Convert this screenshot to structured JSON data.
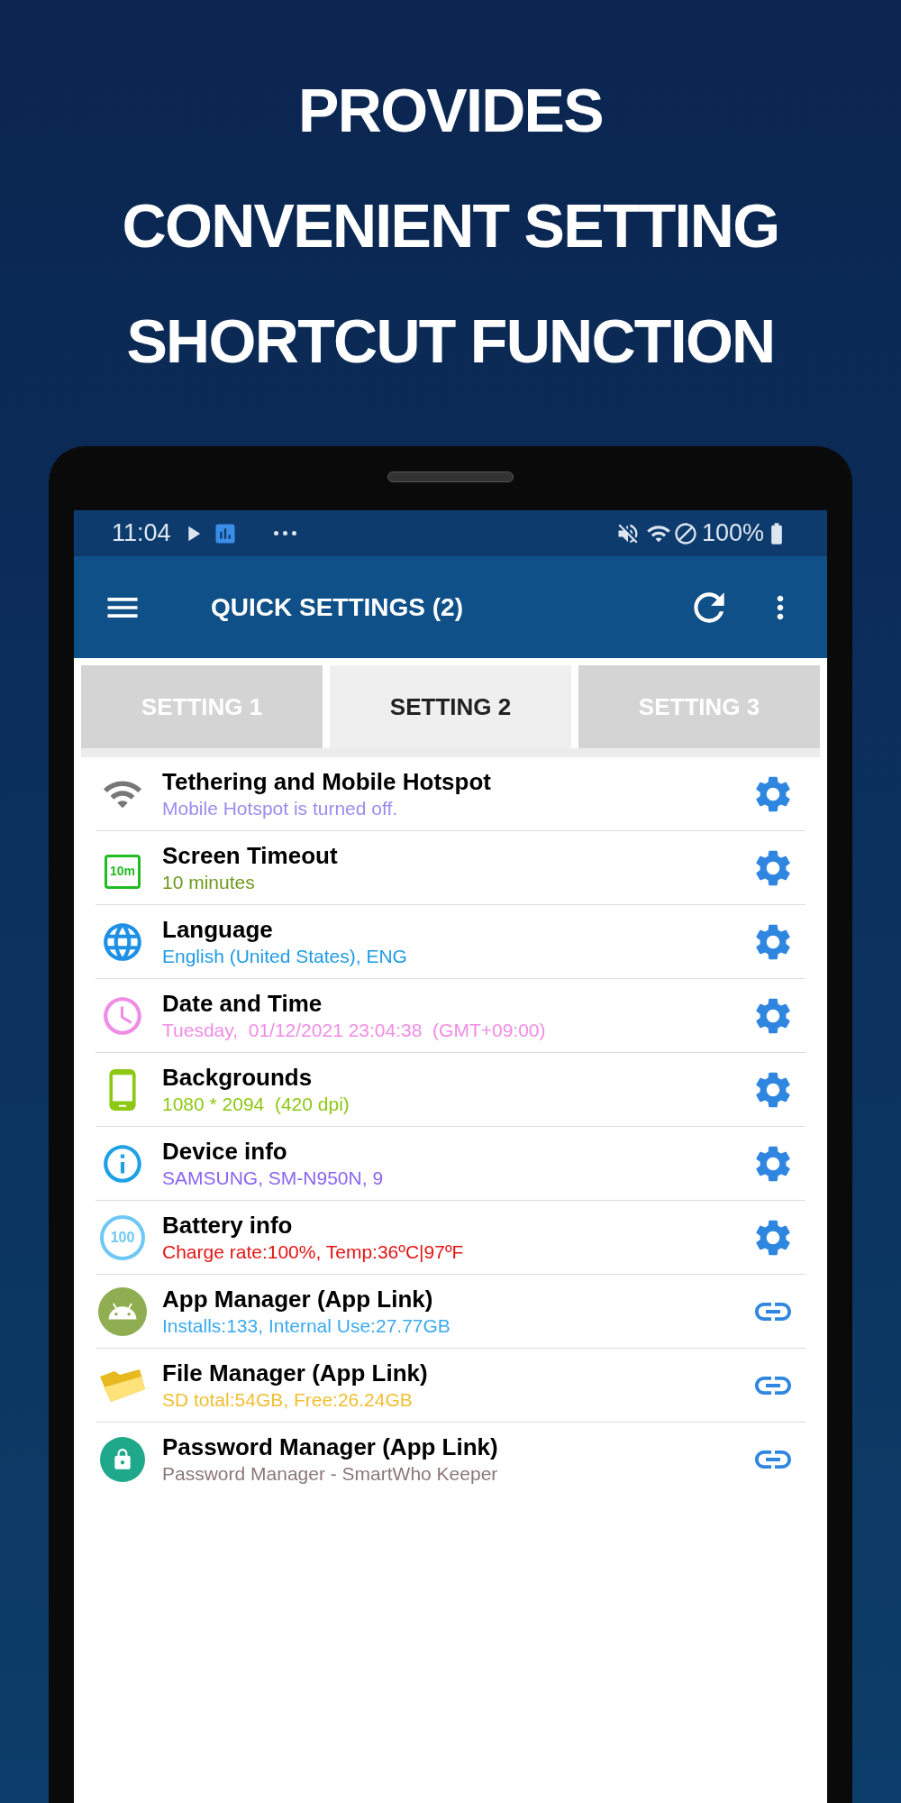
{
  "headline": [
    "PROVIDES",
    "CONVENIENT SETTING",
    "SHORTCUT FUNCTION"
  ],
  "status_bar": {
    "time": "11:04",
    "battery": "100%"
  },
  "app_bar": {
    "title": "QUICK SETTINGS (2)"
  },
  "tabs": [
    {
      "label": "SETTING 1",
      "selected": false
    },
    {
      "label": "SETTING 2",
      "selected": true
    },
    {
      "label": "SETTING 3",
      "selected": false
    }
  ],
  "items": [
    {
      "title": "Tethering and Mobile Hotspot",
      "subtitle": "Mobile Hotspot is turned off.",
      "color": "#9b8cf0",
      "kind": "setting"
    },
    {
      "title": "Screen Timeout",
      "subtitle": "10 minutes",
      "color": "#6e9a1e",
      "kind": "setting",
      "icon_text": "10m"
    },
    {
      "title": "Language",
      "subtitle": "English (United States), ENG",
      "color": "#1e9be6",
      "kind": "setting"
    },
    {
      "title": "Date and Time",
      "subtitle": "Tuesday,  01/12/2021 23:04:38  (GMT+09:00)",
      "color": "#f08ce6",
      "kind": "setting"
    },
    {
      "title": "Backgrounds",
      "subtitle": "1080 * 2094  (420 dpi)",
      "color": "#8cc814",
      "kind": "setting"
    },
    {
      "title": "Device info",
      "subtitle": "SAMSUNG, SM-N950N, 9",
      "color": "#8c64f0",
      "kind": "setting"
    },
    {
      "title": "Battery info",
      "subtitle": "Charge rate:100%, Temp:36ºC|97ºF",
      "color": "#e61414",
      "kind": "setting",
      "icon_text": "100"
    },
    {
      "title": "App Manager (App Link)",
      "subtitle": "Installs:133, Internal Use:27.77GB",
      "color": "#3caaf0",
      "kind": "link"
    },
    {
      "title": "File Manager (App Link)",
      "subtitle": "SD total:54GB, Free:26.24GB",
      "color": "#f0be32",
      "kind": "link"
    },
    {
      "title": "Password Manager (App Link)",
      "subtitle": "Password Manager - SmartWho Keeper",
      "color": "#8c7878",
      "kind": "link"
    }
  ]
}
